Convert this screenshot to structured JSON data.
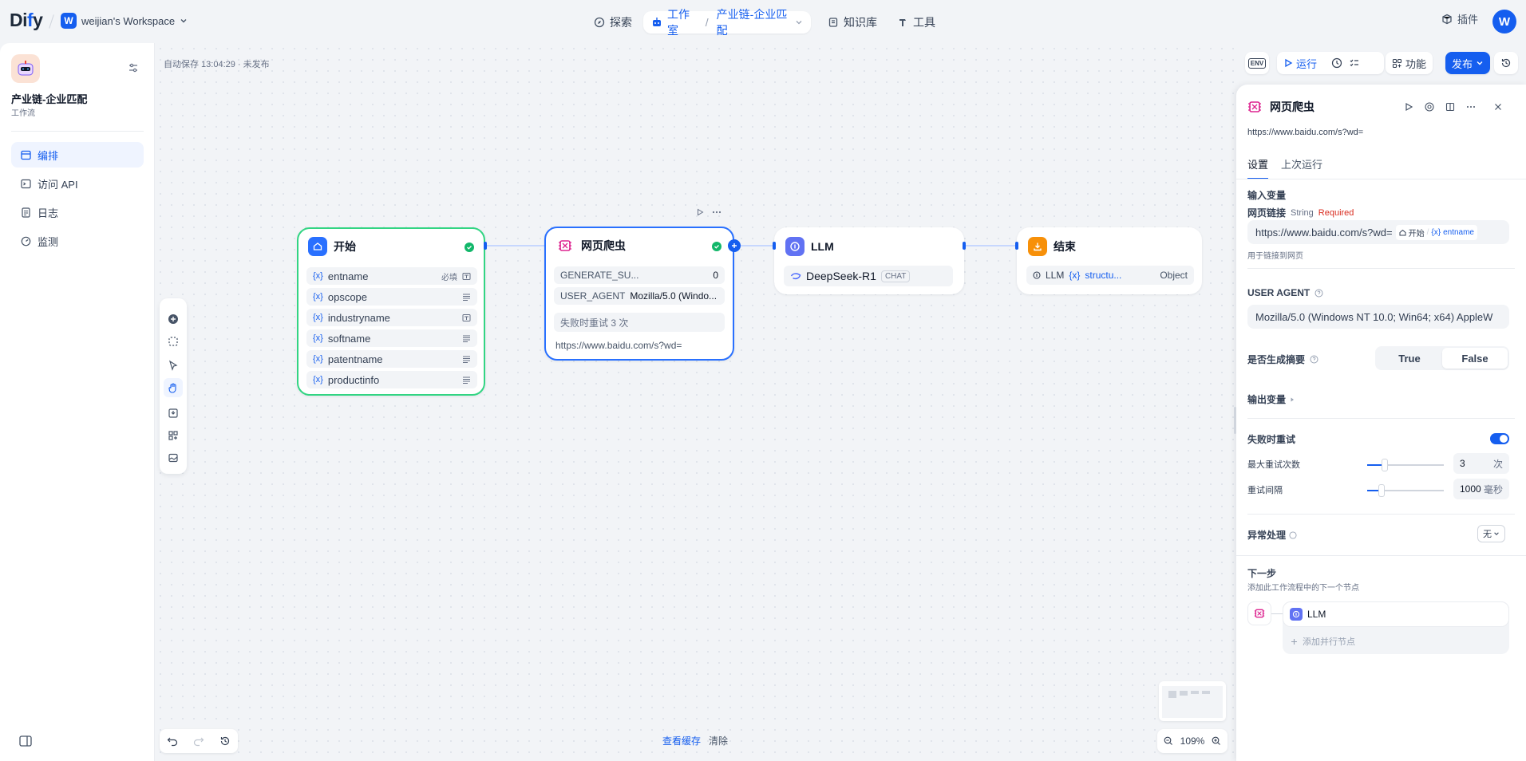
{
  "header": {
    "logo": "Dify",
    "workspace_initial": "W",
    "workspace_name": "weijian's Workspace",
    "nav_explore": "探索",
    "nav_studio": "工作室",
    "nav_app": "产业链-企业匹配",
    "nav_knowledge": "知识库",
    "nav_tools": "工具",
    "plugins": "插件",
    "user_initial": "W"
  },
  "sidebar": {
    "app_title": "产业链-企业匹配",
    "app_type": "工作流",
    "items": [
      {
        "label": "编排"
      },
      {
        "label": "访问 API"
      },
      {
        "label": "日志"
      },
      {
        "label": "监测"
      }
    ]
  },
  "canvas": {
    "autosave": "自动保存 13:04:29 · 未发布",
    "cache_link": "查看缓存",
    "clear": "清除",
    "zoom": "109%"
  },
  "toolbar_top": {
    "env": "ENV",
    "run": "运行",
    "features": "功能",
    "publish": "发布"
  },
  "nodes": {
    "start": {
      "title": "开始",
      "vars": [
        {
          "name": "entname",
          "tag": "必填"
        },
        {
          "name": "opscope"
        },
        {
          "name": "industryname"
        },
        {
          "name": "softname"
        },
        {
          "name": "patentname"
        },
        {
          "name": "productinfo"
        }
      ]
    },
    "crawler": {
      "title": "网页爬虫",
      "row1_key": "GENERATE_SU...",
      "row1_val": "0",
      "row2_key": "USER_AGENT",
      "row2_val": "Mozilla/5.0 (Windo...",
      "retry": "失败时重试 3 次",
      "url": "https://www.baidu.com/s?wd="
    },
    "llm": {
      "title": "LLM",
      "model": "DeepSeek-R1",
      "model_tag": "CHAT"
    },
    "end": {
      "title": "结束",
      "src": "LLM",
      "var": "structu...",
      "type": "Object"
    }
  },
  "panel": {
    "title": "网页爬虫",
    "desc": "https://www.baidu.com/s?wd=",
    "tab_settings": "设置",
    "tab_last_run": "上次运行",
    "input_vars": "输入变量",
    "url_label": "网页链接",
    "url_type": "String",
    "url_required": "Required",
    "url_value": "https://www.baidu.com/s?wd=",
    "url_chip_node": "开始",
    "url_chip_var": "entname",
    "url_hint": "用于链接到网页",
    "ua_label": "USER AGENT",
    "ua_value": "Mozilla/5.0 (Windows NT 10.0; Win64; x64) AppleW",
    "summary_label": "是否生成摘要",
    "true_label": "True",
    "false_label": "False",
    "output_vars": "输出变量",
    "retry_label": "失败时重试",
    "max_retry_label": "最大重试次数",
    "max_retry_value": "3",
    "max_retry_unit": "次",
    "interval_label": "重试间隔",
    "interval_value": "1000",
    "interval_unit": "毫秒",
    "error_label": "异常处理",
    "error_value": "无",
    "next_label": "下一步",
    "next_desc": "添加此工作流程中的下一个节点",
    "next_node": "LLM",
    "add_parallel": "添加并行节点"
  },
  "colors": {
    "accent": "#155eef",
    "success": "#12b76a",
    "required": "#d92d20",
    "crawler_icon": "#dd2590",
    "end_icon": "#f79009",
    "llm_icon": "#6172f3"
  }
}
